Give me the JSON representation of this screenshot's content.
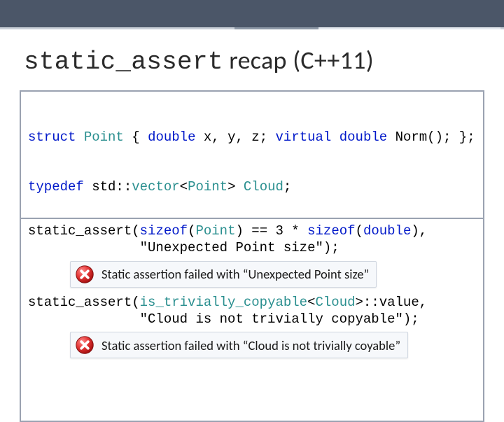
{
  "title": {
    "mono": "static_assert",
    "rest": " recap (C++11)"
  },
  "box1": {
    "line1_parts": [
      "struct",
      " ",
      "Point",
      " { ",
      "double",
      " x, y, z; ",
      "virtual",
      " ",
      "double",
      " Norm(); };"
    ],
    "line1_classes": [
      "kw",
      "",
      "type",
      "",
      "kw",
      "",
      "kw",
      "",
      "kw",
      ""
    ],
    "line2_parts": [
      "typedef",
      " std::",
      "vector",
      "<",
      "Point",
      "> ",
      "Cloud",
      ";"
    ],
    "line2_classes": [
      "kw",
      "",
      "type",
      "",
      "type",
      "",
      "type",
      ""
    ]
  },
  "box2": {
    "block1": {
      "l1_parts": [
        "static_assert(",
        "sizeof",
        "(",
        "Point",
        ") == 3 * ",
        "sizeof",
        "(",
        "double",
        "),"
      ],
      "l1_classes": [
        "",
        "kw",
        "",
        "type",
        "",
        "kw",
        "",
        "kw",
        ""
      ],
      "l2_parts": [
        "              \"Unexpected Point size\");"
      ],
      "l2_classes": [
        ""
      ],
      "err": "Static assertion failed with “Unexpected Point size”"
    },
    "block2": {
      "l1_parts": [
        "static_assert(",
        "is_trivially_copyable",
        "<",
        "Cloud",
        ">::value,"
      ],
      "l1_classes": [
        "",
        "type",
        "",
        "type",
        ""
      ],
      "l2_parts": [
        "              \"Cloud is not trivially copyable\");"
      ],
      "l2_classes": [
        ""
      ],
      "err": "Static assertion failed with “Cloud is not trivially coyable”"
    }
  },
  "icon": {
    "name": "error-x"
  }
}
